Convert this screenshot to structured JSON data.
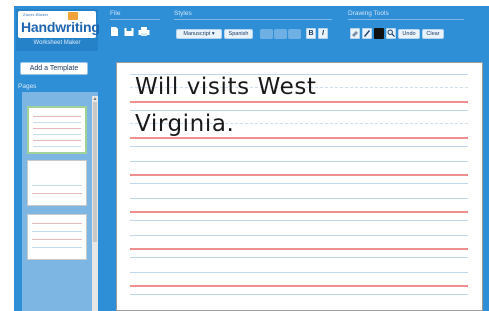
{
  "app": {
    "logo_small": "Zaner-Bloser",
    "logo_title": "Handwriting",
    "logo_subtitle": "Worksheet Maker",
    "help_label": "?"
  },
  "toolbar": {
    "file_label": "File",
    "styles_label": "Styles",
    "drawing_tools_label": "Drawing Tools",
    "style_select_value": "Manuscript",
    "spanish_label": "Spanish",
    "bold_label": "B",
    "italic_label": "I",
    "undo_label": "Undo",
    "clear_label": "Clear"
  },
  "sidebar": {
    "add_template_label": "Add a Template",
    "pages_label": "Pages"
  },
  "worksheet": {
    "lines": [
      "Will visits West",
      "Virginia."
    ]
  },
  "colors": {
    "toolbar_blue": "#2f8fd6",
    "guide_red": "#f08f8f",
    "guide_blue": "#bfd8ef",
    "selected_thumb": "#9fd29a"
  }
}
